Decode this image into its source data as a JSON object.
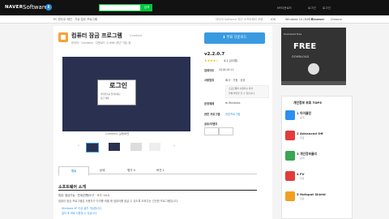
{
  "header": {
    "brand": "NAVER",
    "app": "Software",
    "app_icon": "download-circle-icon",
    "search_button": "검색",
    "links": [
      "MY다운로드",
      "로그인",
      "로그인"
    ]
  },
  "subnav": {
    "breadcrumb": [
      "PC 윈도우 메인",
      "가상 업무 프로그램"
    ],
    "promo": "네이버 Software 최신 소프트웨어 모음",
    "os_options": [
      "iOS",
      "Windows 10 (64비트)",
      "Browser",
      "Chrome"
    ]
  },
  "app": {
    "title": "컴퓨터 잠금 프로그램",
    "small_tag": "Comteck",
    "meta": "한국어  ·  Comteck  ·  다운로드 수 698 (최근 7일) 등",
    "download_button": "무료 다운로드",
    "version": "v2.2.0.7",
    "stars": "★★★★☆",
    "rating": "4.2",
    "rating_count": "(22명)",
    "update_label": "업데이트",
    "update_date": "2018.04.11",
    "license_label": "사용범위",
    "license_value": "회사 · 가정 · 공공",
    "notice_line1": "소프트웨어 사용자는 회사 ·",
    "notice_line2": "업체 확인을 할 수 있습니다.",
    "os_label": "운영체제",
    "os_value": "Windows",
    "related_label": "관련 프로그램",
    "related_value": "관련프로그램",
    "share_label": "공유/이벤트"
  },
  "screenshot": {
    "login_text": "로그인",
    "line1": "비밀번호를 입력하세요",
    "line2": "잠금 해제",
    "caption": "Comteck 실행화면"
  },
  "tabs": [
    "개요",
    "상세",
    "평가",
    "버전"
  ],
  "tab_counts": [
    "",
    "",
    "0",
    "1"
  ],
  "intro": {
    "title": "소프트웨어 소개",
    "features": "특징: 잠금기능   ·   연계(진행)도구   ·   크기: 10.5",
    "description": "컴퓨터 잠금 프로그램은 사용자가 자리를 비울 때 컴퓨터를 잠글 수 있도록 도와주는 간단한 프로그램입니다.",
    "bullet1": "Windows XP 이상 설치 가능합니다.",
    "bullet2": "설치 후 바로 사용할 수 있습니다."
  },
  "ad": {
    "header": "Download Free",
    "headline": "FREE",
    "sub": "DOWNLOAD"
  },
  "tops": {
    "title": "개인정보 보호 TOP5",
    "items": [
      {
        "rank": "1",
        "name": "아이클린",
        "sub": "공개"
      },
      {
        "rank": "2",
        "name": "Advanced Off",
        "sub": "무료"
      },
      {
        "rank": "3",
        "name": "개인정보클리",
        "sub": "공개"
      },
      {
        "rank": "4",
        "name": "FV",
        "sub": "무료"
      },
      {
        "rank": "5",
        "name": "Hotspot Shield",
        "sub": "무료"
      }
    ],
    "icon_colors": [
      "#2c8ff0",
      "#e23b3b",
      "#3aa555",
      "#e23b3b",
      "#f0a020"
    ]
  }
}
